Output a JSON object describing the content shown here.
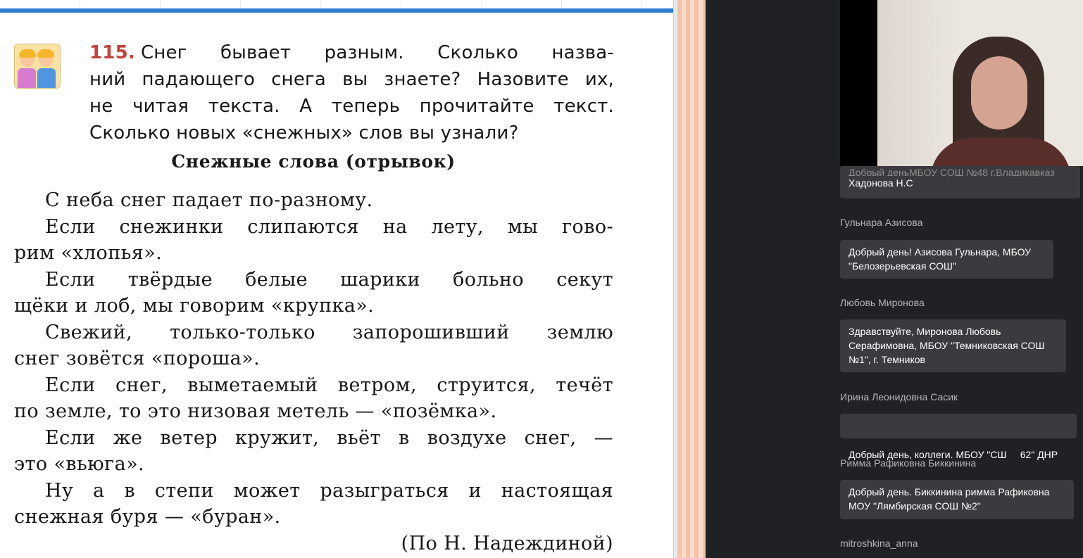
{
  "task": {
    "number": "115.",
    "lines": [
      "Снег бывает разным. Сколько назва-",
      "ний падающего снега вы знаете? Назовите их,",
      "не читая текста. А теперь прочитайте текст.",
      "Сколько новых «снежных» слов вы узнали?"
    ]
  },
  "story": {
    "title": "Снежные слова (отрывок)",
    "lines": [
      "С неба снег падает по-разному.",
      "Если снежинки слипаются на лету, мы гово-",
      "рим «хлопья».",
      "Если твёрдые белые шарики больно секут",
      "щёки и лоб, мы говорим «крупка».",
      "Свежий, только-только запорошивший землю",
      "снег зовётся «пороша».",
      "Если снег, выметаемый ветром, струится, течёт",
      "по земле, то это низовая метель — «позёмка».",
      "Если же ветер кружит, вьёт в воздухе снег, —",
      "это «вьюга».",
      "Ну а в степи может разыграться и настоящая",
      "снежная буря — «буран»."
    ],
    "attribution": "(По Н. Надеждиной)"
  },
  "chat": {
    "partial_message": {
      "line1": "Добрый деньМБОУ СОШ №48 г.Владикавказ",
      "line2": "Хадонова Н.С"
    },
    "messages": [
      {
        "sender": "Гульнара Азисова",
        "lines": [
          "Добрый день! Азисова Гульнара, МБОУ",
          "\"Белозерьевская СОШ\""
        ]
      },
      {
        "sender": "Любовь Миронова",
        "lines": [
          "Здравствуйте, Миронова Любовь",
          "Серафимовна, МБОУ \"Темниковская СОШ",
          "№1\", г. Темников"
        ]
      },
      {
        "sender": "Ирина Леонидовна Сасик",
        "lines": [
          "Добрый день, коллеги. МБОУ \"СШ     62\" ДНР"
        ]
      },
      {
        "sender": "Римма Рафиковна Биккинина",
        "lines": [
          "Добрый день. Биккинина римма Рафиковна",
          "МОУ \"Лямбирская СОШ №2\""
        ]
      }
    ],
    "last_sender": "mitroshkina_anna"
  },
  "colors": {
    "page_accent": "#2f7fd0",
    "task_number": "#c0443b",
    "chat_bg": "#202124",
    "chat_bubble": "#3a3b3e"
  },
  "icons": [
    "kids-icon"
  ]
}
